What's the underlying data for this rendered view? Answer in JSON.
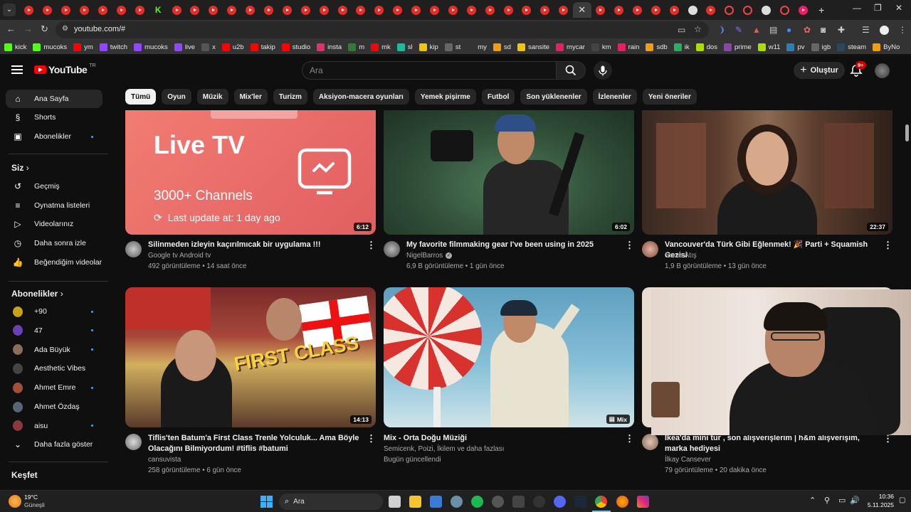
{
  "browser": {
    "url": "youtube.com/#",
    "active_tab_close": "✕",
    "new_tab": "+",
    "bookmarks": [
      {
        "label": "kick",
        "color": "#53fc18"
      },
      {
        "label": "mucoks",
        "color": "#53fc18"
      },
      {
        "label": "ym",
        "color": "#ff0000"
      },
      {
        "label": "twitch",
        "color": "#9146ff"
      },
      {
        "label": "mucoks",
        "color": "#9146ff"
      },
      {
        "label": "live",
        "color": "#9146ff"
      },
      {
        "label": "x",
        "color": "#555555"
      },
      {
        "label": "u2b",
        "color": "#ff0000"
      },
      {
        "label": "takip",
        "color": "#ff0000"
      },
      {
        "label": "studio",
        "color": "#ff0000"
      },
      {
        "label": "insta",
        "color": "#e1306c"
      },
      {
        "label": "m",
        "color": "#2e7d32"
      },
      {
        "label": "mk",
        "color": "#ff0000"
      },
      {
        "label": "sl",
        "color": "#1abc9c"
      },
      {
        "label": "kip",
        "color": "#f1c40f"
      },
      {
        "label": "st",
        "color": "#666666"
      },
      {
        "label": "my",
        "color": "#333333"
      },
      {
        "label": "sd",
        "color": "#f39c12"
      },
      {
        "label": "sansite",
        "color": "#f1c40f"
      },
      {
        "label": "mycar",
        "color": "#e91e63"
      },
      {
        "label": "km",
        "color": "#444444"
      },
      {
        "label": "rain",
        "color": "#e91e63"
      },
      {
        "label": "sdb",
        "color": "#f39c12"
      },
      {
        "label": "ik",
        "color": "#27ae60"
      },
      {
        "label": "dos",
        "color": "#aadd00"
      },
      {
        "label": "prime",
        "color": "#8e44ad"
      },
      {
        "label": "w11",
        "color": "#aadd00"
      },
      {
        "label": "pv",
        "color": "#2980b9"
      },
      {
        "label": "igb",
        "color": "#666666"
      },
      {
        "label": "steam",
        "color": "#2a475e"
      },
      {
        "label": "ByNo",
        "color": "#f39c12"
      }
    ]
  },
  "header": {
    "logo_text": "YouTube",
    "logo_region": "TR",
    "search_placeholder": "Ara",
    "create_label": "Oluştur",
    "notif_badge": "9+"
  },
  "sidebar": {
    "main": [
      {
        "label": "Ana Sayfa",
        "icon": "home-icon",
        "glyph": "⌂"
      },
      {
        "label": "Shorts",
        "icon": "shorts-icon",
        "glyph": "§"
      },
      {
        "label": "Abonelikler",
        "icon": "subscriptions-icon",
        "glyph": "▣"
      }
    ],
    "you_heading": "Siz",
    "you_items": [
      {
        "label": "Geçmiş",
        "icon": "history-icon",
        "glyph": "↺"
      },
      {
        "label": "Oynatma listeleri",
        "icon": "playlists-icon",
        "glyph": "≡"
      },
      {
        "label": "Videolarınız",
        "icon": "your-videos-icon",
        "glyph": "▷"
      },
      {
        "label": "Daha sonra izle",
        "icon": "watch-later-icon",
        "glyph": "◷"
      },
      {
        "label": "Beğendiğim videolar",
        "icon": "liked-icon",
        "glyph": "👍"
      }
    ],
    "subs_heading": "Abonelikler",
    "subs": [
      {
        "label": "+90",
        "color": "#c8a21a"
      },
      {
        "label": "47",
        "color": "#6a3fb5"
      },
      {
        "label": "Ada Büyük",
        "color": "#8a6d5a"
      },
      {
        "label": "Aesthetic Vibes",
        "color": "#444444"
      },
      {
        "label": "Ahmet Emre",
        "color": "#a0503a"
      },
      {
        "label": "Ahmet Özdaş",
        "color": "#556677"
      },
      {
        "label": "aisu",
        "color": "#8a3a3a"
      }
    ],
    "show_more": "Daha fazla göster",
    "explore_heading": "Keşfet"
  },
  "chips": [
    "Tümü",
    "Oyun",
    "Müzik",
    "Mix'ler",
    "Turizm",
    "Aksiyon-macera oyunları",
    "Yemek pişirme",
    "Futbol",
    "Son yüklenenler",
    "İzlenenler",
    "Yeni öneriler"
  ],
  "videos": [
    {
      "title": "Silinmeden izleyin kaçırılmıcak bir uygulama !!!",
      "channel": "Google tv Android tv",
      "stats": "492 görüntüleme • 14 saat önce",
      "duration": "6:12",
      "thumb_text_1": "Live TV",
      "thumb_text_2": "3000+ Channels",
      "thumb_text_3": "Last update at: 1 day ago"
    },
    {
      "title": "My favorite filmmaking gear I've been using in 2025",
      "channel": "NigelBarros",
      "stats": "6,9 B görüntüleme • 1 gün önce",
      "duration": "6:02"
    },
    {
      "title": "Vancouver'da Türk Gibi Eğlenmek! 🎉 Parti + Squamish Gezisi",
      "channel": "Sema Atış",
      "stats": "1,9 B görüntüleme • 13 gün önce",
      "duration": "22:37"
    },
    {
      "title": "Tiflis'ten Batum'a First Class Trenle Yolculuk... Ama Böyle Olacağını Bilmiyordum! #tiflis #batumi",
      "channel": "cansuvista",
      "stats": "258 görüntüleme • 6 gün önce",
      "duration": "14:13",
      "thumb_text_1": "FIRST CLASS"
    },
    {
      "title": "Mix - Orta Doğu Müziği",
      "channel": "Semicenk, Poizi, İkilem ve daha fazlası",
      "stats": "Bugün güncellendi",
      "duration": "Mix"
    },
    {
      "title": "Ikea'da mini tur , son alışverişlerim | h&m alışverişim, marka hediyesi",
      "channel": "İlkay Cansever",
      "stats": "79 görüntüleme • 20 dakika önce",
      "duration": ""
    }
  ],
  "taskbar": {
    "weather_temp": "19°C",
    "weather_desc": "Güneşli",
    "search_label": "Ara",
    "time": "10:36",
    "date": "5.11.2025"
  }
}
